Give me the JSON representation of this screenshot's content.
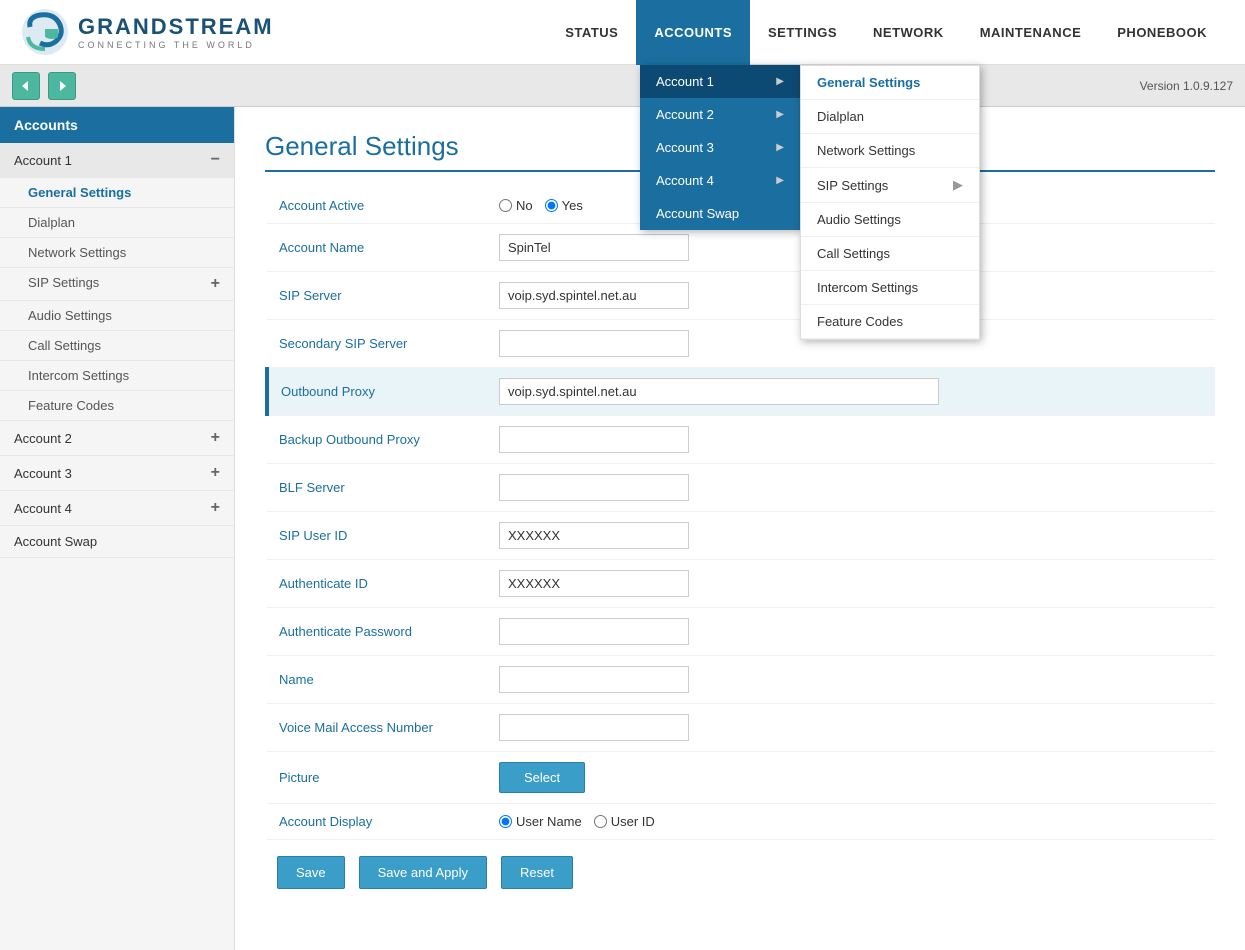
{
  "header": {
    "logo_brand": "GRANDSTREAM",
    "logo_tagline": "CONNECTING THE WORLD",
    "version": "Version 1.0.9.127",
    "nav_items": [
      {
        "label": "STATUS",
        "active": false
      },
      {
        "label": "ACCOUNTS",
        "active": true
      },
      {
        "label": "SETTINGS",
        "active": false
      },
      {
        "label": "NETWORK",
        "active": false
      },
      {
        "label": "MAINTENANCE",
        "active": false
      },
      {
        "label": "PHONEBOOK",
        "active": false
      }
    ]
  },
  "sidebar": {
    "header": "Accounts",
    "items": [
      {
        "label": "Account 1",
        "expanded": true
      },
      {
        "label": "General Settings",
        "sub": true,
        "active": true
      },
      {
        "label": "Dialplan",
        "sub": true
      },
      {
        "label": "Network Settings",
        "sub": true
      },
      {
        "label": "SIP Settings",
        "sub": true,
        "expandable": true
      },
      {
        "label": "Audio Settings",
        "sub": true
      },
      {
        "label": "Call Settings",
        "sub": true
      },
      {
        "label": "Intercom Settings",
        "sub": true
      },
      {
        "label": "Feature Codes",
        "sub": true
      },
      {
        "label": "Account 2",
        "expanded": false
      },
      {
        "label": "Account 3",
        "expanded": false
      },
      {
        "label": "Account 4",
        "expanded": false
      },
      {
        "label": "Account Swap",
        "expanded": false
      }
    ]
  },
  "page_title": "General Settings",
  "form": {
    "fields": [
      {
        "label": "Account Active",
        "type": "radio",
        "options": [
          "No",
          "Yes"
        ],
        "value": "Yes"
      },
      {
        "label": "Account Name",
        "type": "text",
        "value": "SpinTel"
      },
      {
        "label": "SIP Server",
        "type": "text",
        "value": "voip.syd.spintel.net.au"
      },
      {
        "label": "Secondary SIP Server",
        "type": "text",
        "value": ""
      },
      {
        "label": "Outbound Proxy",
        "type": "text",
        "value": "voip.syd.spintel.net.au",
        "highlighted": true
      },
      {
        "label": "Backup Outbound Proxy",
        "type": "text",
        "value": ""
      },
      {
        "label": "BLF Server",
        "type": "text",
        "value": ""
      },
      {
        "label": "SIP User ID",
        "type": "text",
        "value": "XXXXXX"
      },
      {
        "label": "Authenticate ID",
        "type": "text",
        "value": "XXXXXX"
      },
      {
        "label": "Authenticate Password",
        "type": "text",
        "value": ""
      },
      {
        "label": "Name",
        "type": "text",
        "value": ""
      },
      {
        "label": "Voice Mail Access Number",
        "type": "text",
        "value": ""
      },
      {
        "label": "Picture",
        "type": "button",
        "button_label": "Select"
      },
      {
        "label": "Account Display",
        "type": "radio",
        "options": [
          "User Name",
          "User ID"
        ],
        "value": "User Name"
      }
    ],
    "buttons": {
      "save": "Save",
      "save_apply": "Save and Apply",
      "reset": "Reset"
    }
  },
  "dropdown": {
    "visible": true,
    "accounts": [
      {
        "label": "Account 1",
        "active": true,
        "has_sub": true
      },
      {
        "label": "Account 2",
        "active": false,
        "has_sub": true
      },
      {
        "label": "Account 3",
        "active": false,
        "has_sub": true
      },
      {
        "label": "Account 4",
        "active": false,
        "has_sub": true
      },
      {
        "label": "Account Swap",
        "active": false,
        "has_sub": false
      }
    ],
    "submenu_items": [
      {
        "label": "General Settings",
        "active": true
      },
      {
        "label": "Dialplan",
        "active": false
      },
      {
        "label": "Network Settings",
        "active": false
      },
      {
        "label": "SIP Settings",
        "active": false,
        "has_sub": true
      },
      {
        "label": "Audio Settings",
        "active": false
      },
      {
        "label": "Call Settings",
        "active": false
      },
      {
        "label": "Intercom Settings",
        "active": false
      },
      {
        "label": "Feature Codes",
        "active": false
      }
    ]
  }
}
